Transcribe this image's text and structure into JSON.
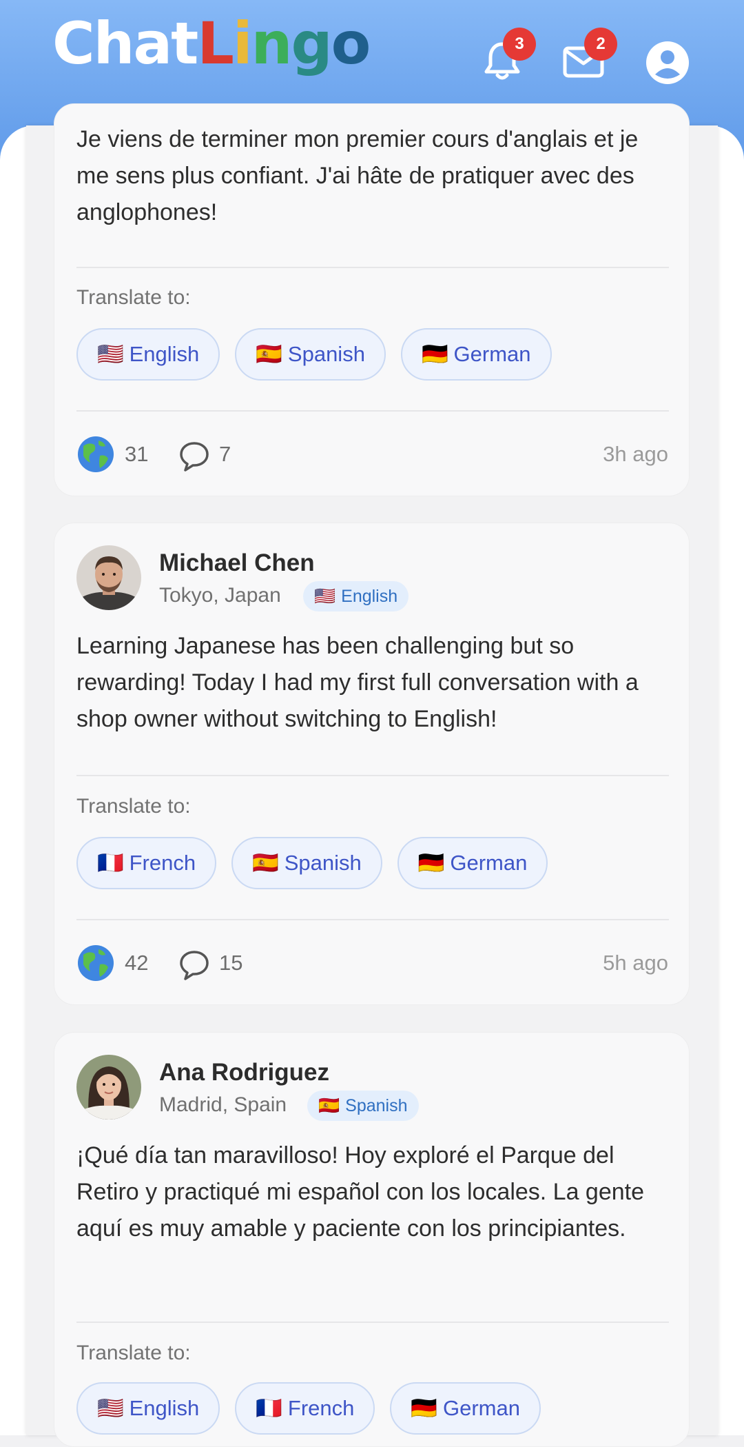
{
  "app": {
    "logo_letters": [
      {
        "ch": "C",
        "color": "#ffffff"
      },
      {
        "ch": "h",
        "color": "#ffffff"
      },
      {
        "ch": "a",
        "color": "#ffffff"
      },
      {
        "ch": "t",
        "color": "#ffffff"
      },
      {
        "ch": "L",
        "color": "#d93a2f"
      },
      {
        "ch": "i",
        "color": "#e9b93a"
      },
      {
        "ch": "n",
        "color": "#3cae5a"
      },
      {
        "ch": "g",
        "color": "#2a8a84"
      },
      {
        "ch": "o",
        "color": "#1f5f8c"
      }
    ],
    "notifications_count": "3",
    "messages_count": "2"
  },
  "posts": [
    {
      "text": "Je viens de terminer mon premier cours d'anglais et je me sens plus confiant. J'ai hâte de pratiquer avec des anglophones!",
      "translate_label": "Translate to:",
      "translate_options": [
        {
          "flag": "🇺🇸",
          "label": "English"
        },
        {
          "flag": "🇪🇸",
          "label": "Spanish"
        },
        {
          "flag": "🇩🇪",
          "label": "German"
        }
      ],
      "likes": "31",
      "comments": "7",
      "time": "3h ago"
    },
    {
      "name": "Michael Chen",
      "location": "Tokyo, Japan",
      "language_flag": "🇺🇸",
      "language": "English",
      "text": "Learning Japanese has been challenging but so rewarding! Today I had my first full conversation with a shop owner without switching to English!",
      "translate_label": "Translate to:",
      "translate_options": [
        {
          "flag": "🇫🇷",
          "label": "French"
        },
        {
          "flag": "🇪🇸",
          "label": "Spanish"
        },
        {
          "flag": "🇩🇪",
          "label": "German"
        }
      ],
      "likes": "42",
      "comments": "15",
      "time": "5h ago"
    },
    {
      "name": "Ana Rodriguez",
      "location": "Madrid, Spain",
      "language_flag": "🇪🇸",
      "language": "Spanish",
      "text": "¡Qué día tan maravilloso! Hoy exploré el Parque del Retiro y practiqué mi español con los locales. La gente aquí es muy amable y paciente con los principiantes.",
      "translate_label": "Translate to:",
      "translate_options": [
        {
          "flag": "🇺🇸",
          "label": "English"
        },
        {
          "flag": "🇫🇷",
          "label": "French"
        },
        {
          "flag": "🇩🇪",
          "label": "German"
        }
      ]
    }
  ]
}
